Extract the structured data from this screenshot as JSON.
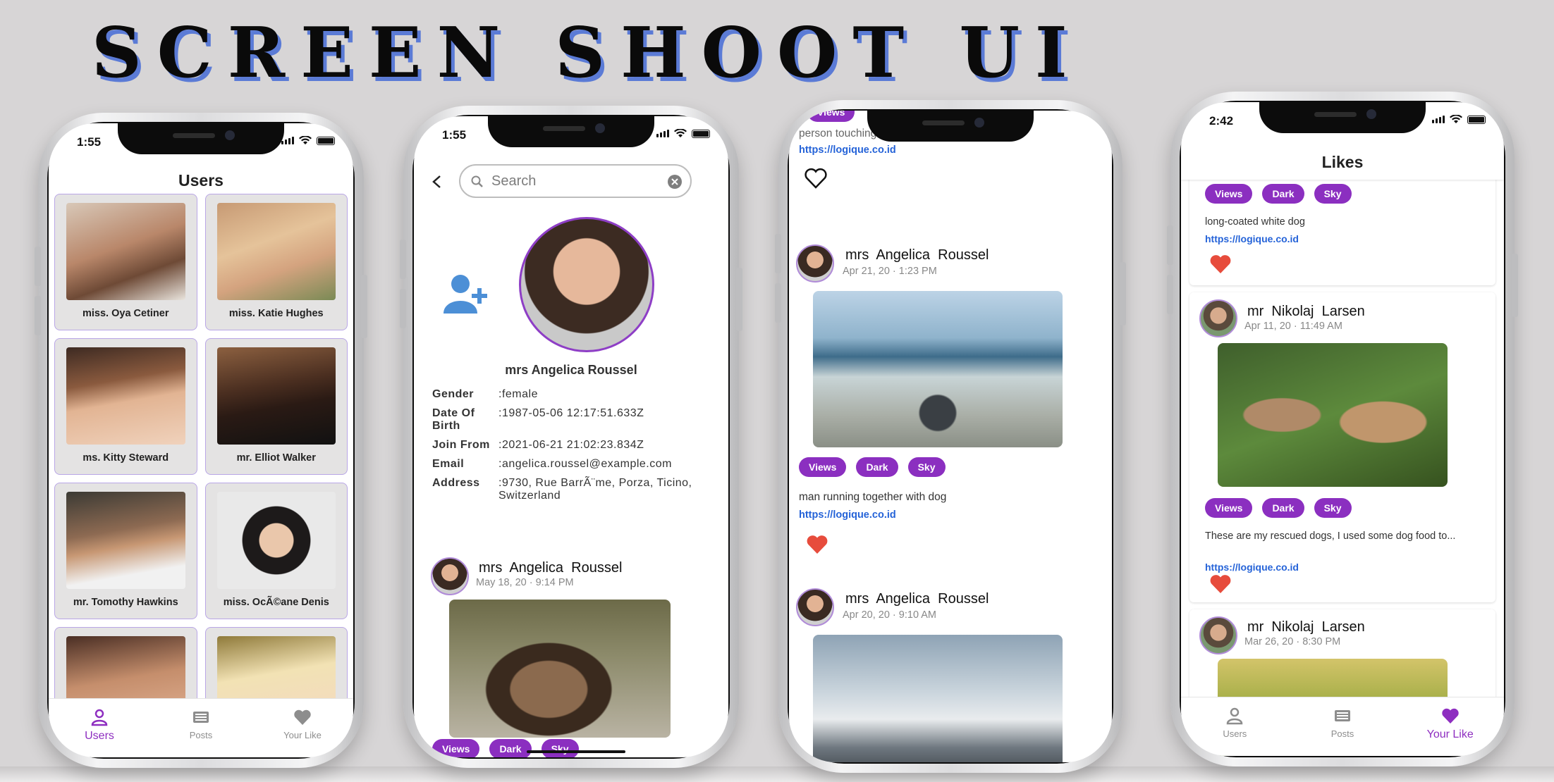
{
  "banner": "SCREEN SHOOT UI",
  "tabs": {
    "users": "Users",
    "posts": "Posts",
    "your_like": "Your Like"
  },
  "screen1": {
    "time": "1:55",
    "title": "Users",
    "users": [
      {
        "name": "miss. Oya Cetiner"
      },
      {
        "name": "miss. Katie Hughes"
      },
      {
        "name": "ms. Kitty Steward"
      },
      {
        "name": "mr. Elliot Walker"
      },
      {
        "name": "mr. Tomothy Hawkins"
      },
      {
        "name": "miss. OcÃ©ane Denis"
      },
      {
        "name": ""
      },
      {
        "name": ""
      }
    ]
  },
  "screen2": {
    "time": "1:55",
    "search_placeholder": "Search",
    "name": "mrs Angelica Roussel",
    "info": [
      {
        "k": "Gender",
        "v": ":female"
      },
      {
        "k": "Date Of Birth",
        "v": ":1987-05-06 12:17:51.633Z"
      },
      {
        "k": "Join From",
        "v": ":2021-06-21 21:02:23.834Z"
      },
      {
        "k": "Email",
        "v": ":angelica.roussel@example.com"
      },
      {
        "k": "Address",
        "v": ":9730, Rue BarrÃ¨me, Porza, Ticino, Switzerland"
      }
    ],
    "post": {
      "author": "mrs  Angelica  Roussel",
      "date": "May 18, 20 · 9:14 PM",
      "chips": [
        "Views",
        "Dark",
        "Sky"
      ]
    }
  },
  "screen3": {
    "top_chip": "Views",
    "top_text": "person touching dog's head",
    "top_link": "https://logique.co.id",
    "post1": {
      "author": "mrs  Angelica  Roussel",
      "date": "Apr 21, 20 · 1:23 PM",
      "chips": [
        "Views",
        "Dark",
        "Sky"
      ],
      "text": "man running together with dog",
      "link": "https://logique.co.id"
    },
    "post2": {
      "author": "mrs  Angelica  Roussel",
      "date": "Apr 20, 20 · 9:10 AM"
    }
  },
  "screen4": {
    "time": "2:42",
    "title": "Likes",
    "card1": {
      "chips": [
        "Views",
        "Dark",
        "Sky"
      ],
      "text": "long-coated white dog",
      "link": "https://logique.co.id"
    },
    "card2": {
      "author": "mr  Nikolaj  Larsen",
      "date": "Apr 11, 20 · 11:49 AM",
      "chips": [
        "Views",
        "Dark",
        "Sky"
      ],
      "text": "These are my rescued dogs, I used some dog food to...",
      "link": "https://logique.co.id"
    },
    "card3": {
      "author": "mr  Nikolaj  Larsen",
      "date": "Mar 26, 20 · 8:30 PM"
    }
  },
  "colors": {
    "accent": "#8b2fc0",
    "link": "#2563d8",
    "heart": "#e74c3c"
  }
}
